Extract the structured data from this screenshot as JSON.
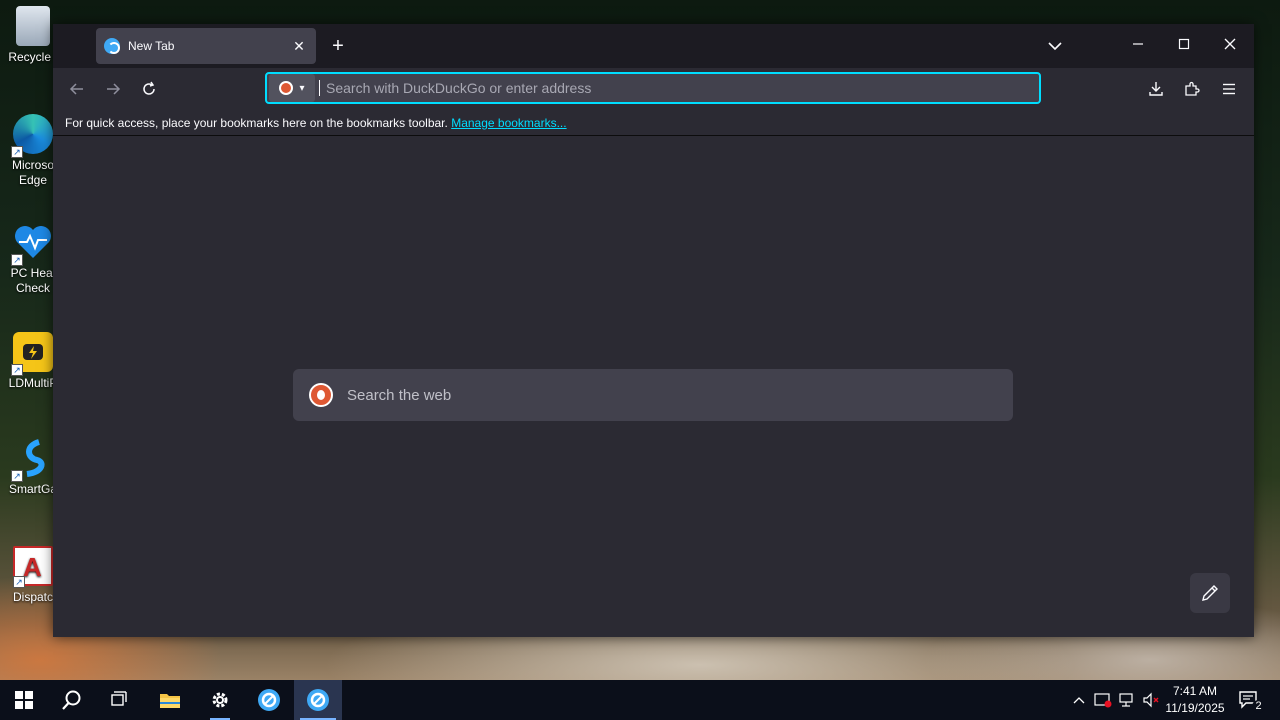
{
  "desktop": {
    "icons": [
      {
        "label": "Recycle I",
        "name": "recycle-bin"
      },
      {
        "label": "Microso Edge",
        "name": "microsoft-edge"
      },
      {
        "label": "PC Heal Check",
        "name": "pc-health-check"
      },
      {
        "label": "LDMultiP",
        "name": "ldmultiplayer"
      },
      {
        "label": "SmartGa",
        "name": "smartgaga"
      },
      {
        "label": "Dispatc",
        "name": "dispatch"
      }
    ]
  },
  "browser": {
    "tab": {
      "title": "New Tab"
    },
    "url_placeholder": "Search with DuckDuckGo or enter address",
    "bookmarks_bar": {
      "text": "For quick access, place your bookmarks here on the bookmarks toolbar.",
      "link": "Manage bookmarks..."
    },
    "web_search_label": "Search the web",
    "accent_color": "#00ddff"
  },
  "taskbar": {
    "time": "7:41 AM",
    "date": "11/19/2025",
    "notification_count": "2"
  }
}
